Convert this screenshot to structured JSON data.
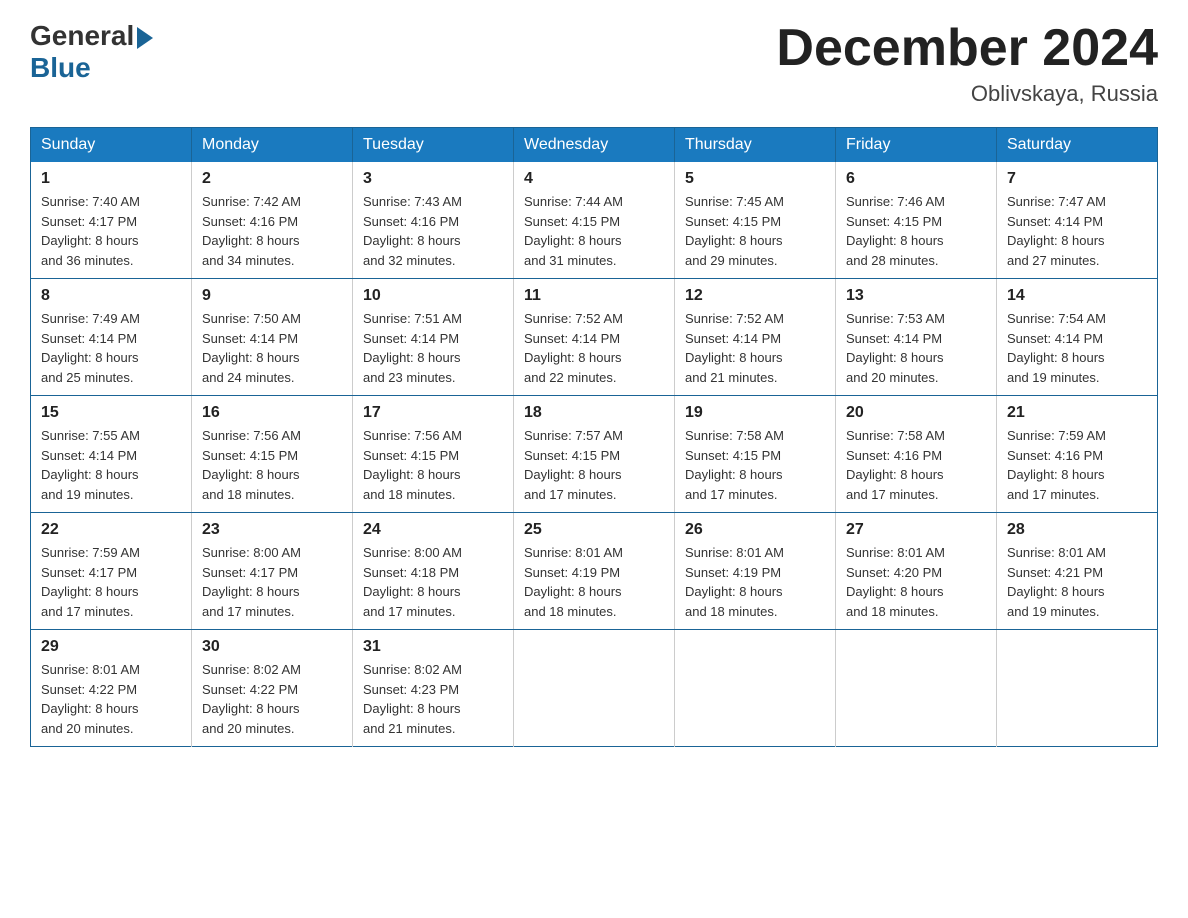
{
  "header": {
    "logo_general": "General",
    "logo_blue": "Blue",
    "month_title": "December 2024",
    "location": "Oblivskaya, Russia"
  },
  "weekdays": [
    "Sunday",
    "Monday",
    "Tuesday",
    "Wednesday",
    "Thursday",
    "Friday",
    "Saturday"
  ],
  "weeks": [
    [
      {
        "day": "1",
        "sunrise": "7:40 AM",
        "sunset": "4:17 PM",
        "daylight_hours": "8 hours",
        "daylight_minutes": "and 36 minutes."
      },
      {
        "day": "2",
        "sunrise": "7:42 AM",
        "sunset": "4:16 PM",
        "daylight_hours": "8 hours",
        "daylight_minutes": "and 34 minutes."
      },
      {
        "day": "3",
        "sunrise": "7:43 AM",
        "sunset": "4:16 PM",
        "daylight_hours": "8 hours",
        "daylight_minutes": "and 32 minutes."
      },
      {
        "day": "4",
        "sunrise": "7:44 AM",
        "sunset": "4:15 PM",
        "daylight_hours": "8 hours",
        "daylight_minutes": "and 31 minutes."
      },
      {
        "day": "5",
        "sunrise": "7:45 AM",
        "sunset": "4:15 PM",
        "daylight_hours": "8 hours",
        "daylight_minutes": "and 29 minutes."
      },
      {
        "day": "6",
        "sunrise": "7:46 AM",
        "sunset": "4:15 PM",
        "daylight_hours": "8 hours",
        "daylight_minutes": "and 28 minutes."
      },
      {
        "day": "7",
        "sunrise": "7:47 AM",
        "sunset": "4:14 PM",
        "daylight_hours": "8 hours",
        "daylight_minutes": "and 27 minutes."
      }
    ],
    [
      {
        "day": "8",
        "sunrise": "7:49 AM",
        "sunset": "4:14 PM",
        "daylight_hours": "8 hours",
        "daylight_minutes": "and 25 minutes."
      },
      {
        "day": "9",
        "sunrise": "7:50 AM",
        "sunset": "4:14 PM",
        "daylight_hours": "8 hours",
        "daylight_minutes": "and 24 minutes."
      },
      {
        "day": "10",
        "sunrise": "7:51 AM",
        "sunset": "4:14 PM",
        "daylight_hours": "8 hours",
        "daylight_minutes": "and 23 minutes."
      },
      {
        "day": "11",
        "sunrise": "7:52 AM",
        "sunset": "4:14 PM",
        "daylight_hours": "8 hours",
        "daylight_minutes": "and 22 minutes."
      },
      {
        "day": "12",
        "sunrise": "7:52 AM",
        "sunset": "4:14 PM",
        "daylight_hours": "8 hours",
        "daylight_minutes": "and 21 minutes."
      },
      {
        "day": "13",
        "sunrise": "7:53 AM",
        "sunset": "4:14 PM",
        "daylight_hours": "8 hours",
        "daylight_minutes": "and 20 minutes."
      },
      {
        "day": "14",
        "sunrise": "7:54 AM",
        "sunset": "4:14 PM",
        "daylight_hours": "8 hours",
        "daylight_minutes": "and 19 minutes."
      }
    ],
    [
      {
        "day": "15",
        "sunrise": "7:55 AM",
        "sunset": "4:14 PM",
        "daylight_hours": "8 hours",
        "daylight_minutes": "and 19 minutes."
      },
      {
        "day": "16",
        "sunrise": "7:56 AM",
        "sunset": "4:15 PM",
        "daylight_hours": "8 hours",
        "daylight_minutes": "and 18 minutes."
      },
      {
        "day": "17",
        "sunrise": "7:56 AM",
        "sunset": "4:15 PM",
        "daylight_hours": "8 hours",
        "daylight_minutes": "and 18 minutes."
      },
      {
        "day": "18",
        "sunrise": "7:57 AM",
        "sunset": "4:15 PM",
        "daylight_hours": "8 hours",
        "daylight_minutes": "and 17 minutes."
      },
      {
        "day": "19",
        "sunrise": "7:58 AM",
        "sunset": "4:15 PM",
        "daylight_hours": "8 hours",
        "daylight_minutes": "and 17 minutes."
      },
      {
        "day": "20",
        "sunrise": "7:58 AM",
        "sunset": "4:16 PM",
        "daylight_hours": "8 hours",
        "daylight_minutes": "and 17 minutes."
      },
      {
        "day": "21",
        "sunrise": "7:59 AM",
        "sunset": "4:16 PM",
        "daylight_hours": "8 hours",
        "daylight_minutes": "and 17 minutes."
      }
    ],
    [
      {
        "day": "22",
        "sunrise": "7:59 AM",
        "sunset": "4:17 PM",
        "daylight_hours": "8 hours",
        "daylight_minutes": "and 17 minutes."
      },
      {
        "day": "23",
        "sunrise": "8:00 AM",
        "sunset": "4:17 PM",
        "daylight_hours": "8 hours",
        "daylight_minutes": "and 17 minutes."
      },
      {
        "day": "24",
        "sunrise": "8:00 AM",
        "sunset": "4:18 PM",
        "daylight_hours": "8 hours",
        "daylight_minutes": "and 17 minutes."
      },
      {
        "day": "25",
        "sunrise": "8:01 AM",
        "sunset": "4:19 PM",
        "daylight_hours": "8 hours",
        "daylight_minutes": "and 18 minutes."
      },
      {
        "day": "26",
        "sunrise": "8:01 AM",
        "sunset": "4:19 PM",
        "daylight_hours": "8 hours",
        "daylight_minutes": "and 18 minutes."
      },
      {
        "day": "27",
        "sunrise": "8:01 AM",
        "sunset": "4:20 PM",
        "daylight_hours": "8 hours",
        "daylight_minutes": "and 18 minutes."
      },
      {
        "day": "28",
        "sunrise": "8:01 AM",
        "sunset": "4:21 PM",
        "daylight_hours": "8 hours",
        "daylight_minutes": "and 19 minutes."
      }
    ],
    [
      {
        "day": "29",
        "sunrise": "8:01 AM",
        "sunset": "4:22 PM",
        "daylight_hours": "8 hours",
        "daylight_minutes": "and 20 minutes."
      },
      {
        "day": "30",
        "sunrise": "8:02 AM",
        "sunset": "4:22 PM",
        "daylight_hours": "8 hours",
        "daylight_minutes": "and 20 minutes."
      },
      {
        "day": "31",
        "sunrise": "8:02 AM",
        "sunset": "4:23 PM",
        "daylight_hours": "8 hours",
        "daylight_minutes": "and 21 minutes."
      },
      null,
      null,
      null,
      null
    ]
  ],
  "labels": {
    "sunrise": "Sunrise:",
    "sunset": "Sunset:",
    "daylight": "Daylight:"
  }
}
